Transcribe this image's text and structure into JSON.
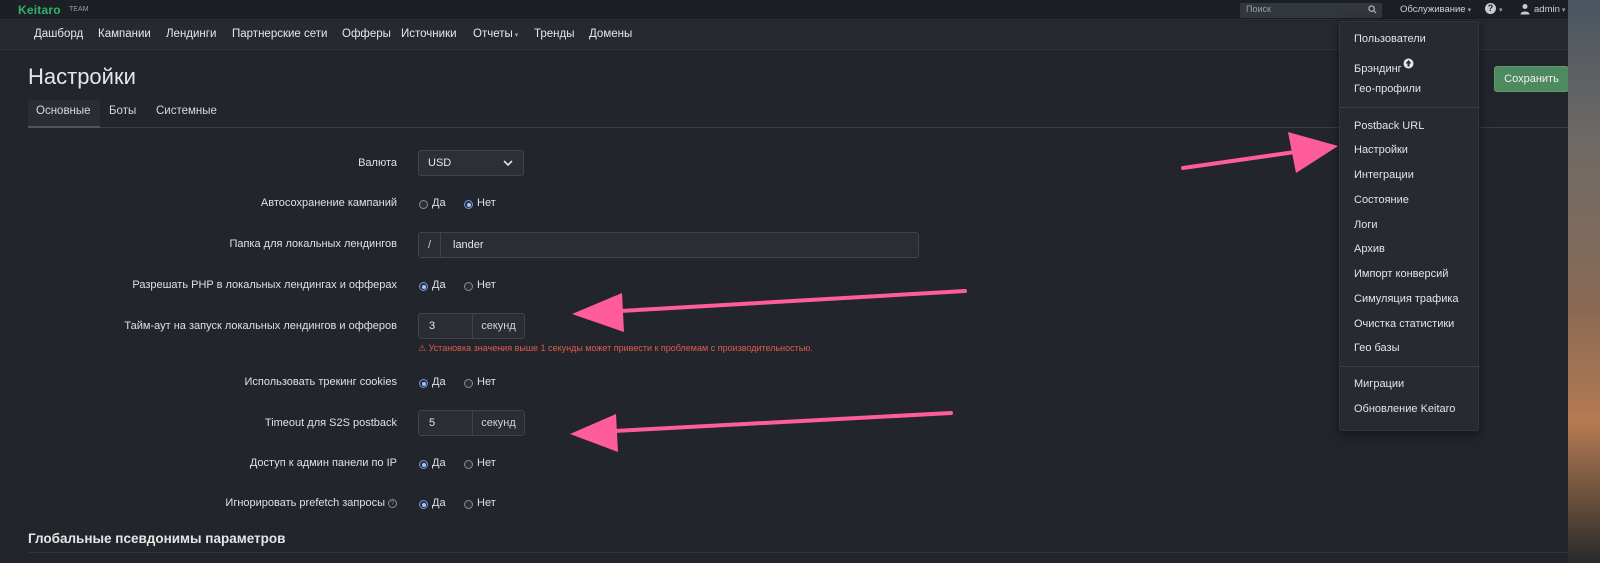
{
  "topbar": {
    "logo": "Keitaro",
    "logo_sub": "TEAM",
    "search_placeholder": "Поиск",
    "service_label": "Обслуживание",
    "help_label": "?",
    "user_label": "admin"
  },
  "nav": {
    "items": [
      "Дашборд",
      "Кампании",
      "Лендинги",
      "Партнерские сети",
      "Офферы",
      "Источники",
      "Отчеты",
      "Тренды",
      "Домены"
    ]
  },
  "page": {
    "title": "Настройки",
    "save_label": "Сохранить",
    "tabs": [
      "Основные",
      "Боты",
      "Системные"
    ]
  },
  "form": {
    "currency_label": "Валюта",
    "currency_value": "USD",
    "autosave_label": "Автосохранение кампаний",
    "autosave_value": "Нет",
    "lander_dir_label": "Папка для локальных лендингов",
    "lander_dir_prefix": "/",
    "lander_dir_value": "lander",
    "php_label": "Разрешать PHP в локальных лендингах и офферах",
    "php_value": "Да",
    "timeout_label": "Тайм-аут на запуск локальных лендингов и офферов",
    "timeout_value": "3",
    "timeout_unit": "секунд",
    "timeout_warning": "⚠ Установка значения выше 1 секунды может привести к проблемам с производительностью.",
    "cookies_label": "Использовать трекинг cookies",
    "cookies_value": "Да",
    "s2s_label": "Timeout для S2S postback",
    "s2s_value": "5",
    "s2s_unit": "секунд",
    "ip_label": "Доступ к админ панели по IP",
    "ip_value": "Да",
    "prefetch_label": "Игнорировать prefetch запросы",
    "prefetch_value": "Да",
    "yes": "Да",
    "no": "Нет"
  },
  "section_title": "Глобальные псевдонимы параметров",
  "dropdown": {
    "group1": [
      "Пользователи",
      "Брэндинг",
      "Гео-профили"
    ],
    "group2": [
      "Postback URL",
      "Настройки",
      "Интеграции",
      "Состояние",
      "Логи",
      "Архив",
      "Импорт конверсий",
      "Симуляция трафика",
      "Очистка статистики",
      "Гео базы"
    ],
    "group3": [
      "Миграции",
      "Обновление Keitaro"
    ]
  },
  "colors": {
    "accent_green": "#4d8a5f",
    "logo_green": "#2fb36b",
    "warning_red": "#e05c4e",
    "arrow_pink": "#ff5c9a"
  },
  "icons": [
    "search-icon",
    "help-icon",
    "user-icon",
    "chevron-down-icon",
    "upload-icon",
    "info-icon",
    "warning-icon"
  ]
}
